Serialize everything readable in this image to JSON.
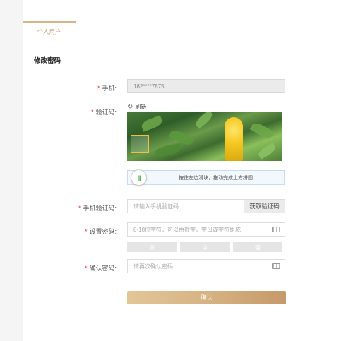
{
  "tabs": [
    {
      "label": "个人用户",
      "active": true
    }
  ],
  "section_title": "修改密码",
  "form": {
    "phone": {
      "label": "手机:",
      "value": "182****7875"
    },
    "captcha": {
      "label": "验证码:",
      "refresh_label": "刷新",
      "slider_hint": "按住左边滑块，拖动完成上方拼图"
    },
    "sms": {
      "label": "手机验证码:",
      "placeholder": "请输入手机验证码",
      "button_label": "获取验证码"
    },
    "password": {
      "label": "设置密码:",
      "placeholder": "8-18位字符，可以由数字，字母或字符组成",
      "strength_levels": [
        "弱",
        "中",
        "强"
      ]
    },
    "confirm_password": {
      "label": "确认密码:",
      "placeholder": "请再次确认密码"
    },
    "required_mark": "*",
    "submit_label": "确认"
  },
  "colors": {
    "accent": "#d9b486",
    "required": "#e4393c",
    "button_start": "#e3c797",
    "button_end": "#c6996a",
    "slider_ok": "#5cb85c"
  },
  "icons": {
    "refresh": "refresh-icon",
    "keyboard": "keyboard-icon",
    "slider_handle": "slider-handle-icon"
  }
}
